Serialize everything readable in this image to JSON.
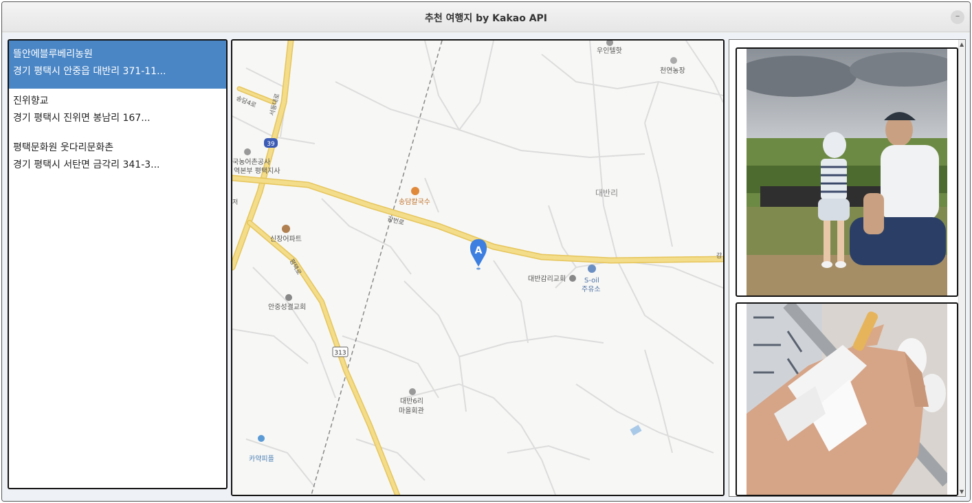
{
  "window": {
    "title": "추천 여행지 by Kakao API",
    "minimize_label": "–"
  },
  "places": [
    {
      "name": "뜰안에블루베리농원",
      "address": "경기 평택시 안중읍 대반리 371-11..."
    },
    {
      "name": "진위향교",
      "address": "경기 평택시 진위면 봉남리 167..."
    },
    {
      "name": "평택문화원 웃다리문화촌",
      "address": "경기 평택시 서탄면 금각리 341-3..."
    }
  ],
  "map": {
    "marker_label": "A",
    "labels": {
      "uindelhat": "우인텔핫",
      "cheonyeon": "천연농장",
      "songdan4ro": "송담4로",
      "seodongdaero": "서동대로",
      "route39": "39",
      "korea_rural": "국농어촌공사",
      "korea_rural_2": "역본부 평택지사",
      "songdam": "송담칼국수",
      "daebanri": "대반리",
      "gameun": "감번로",
      "sinjang": "신장어파트",
      "pyeongtaek_ro": "평택로",
      "daeban_church": "대반감리교회",
      "soil": "S-oil",
      "soil_2": "주유소",
      "anjung_church": "안중성결교회",
      "route313": "313",
      "daeban6": "대반6리",
      "daeban6_2": "마을회관",
      "kayak": "카약피플",
      "side_mark": "저",
      "edge_mark": "감"
    },
    "colors": {
      "road_major": "#f3dc8a",
      "road_major_edge": "#e6c55a",
      "marker": "#3d7fe0",
      "label": "#555555"
    }
  },
  "photos": [
    {
      "icon": "blueberry-farm-photo"
    },
    {
      "icon": "bandaged-hand-photo"
    }
  ],
  "colors": {
    "selected_bg": "#4a86c5"
  }
}
